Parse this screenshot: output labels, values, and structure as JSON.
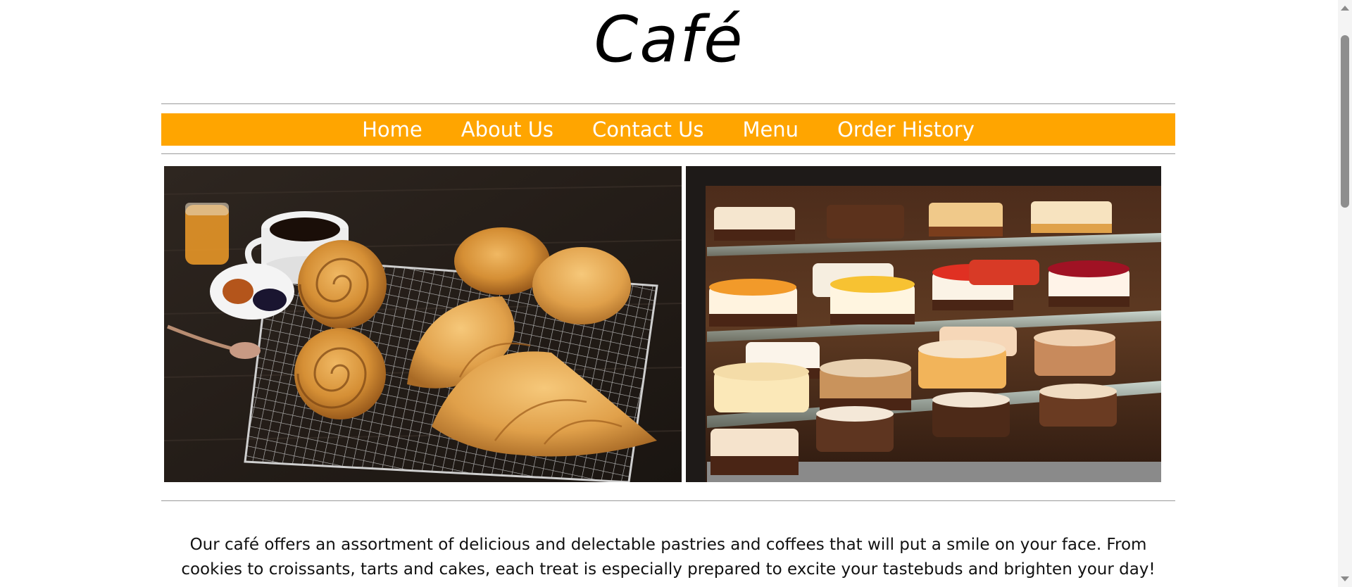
{
  "header": {
    "title": "Café"
  },
  "nav": {
    "items": [
      {
        "label": "Home"
      },
      {
        "label": "About Us"
      },
      {
        "label": "Contact Us"
      },
      {
        "label": "Menu"
      },
      {
        "label": "Order History"
      }
    ],
    "background_color": "#ffa500",
    "text_color": "#ffffff"
  },
  "hero": {
    "left_image": "pastries-and-coffee-photo",
    "right_image": "cake-display-case-photo"
  },
  "main": {
    "description": "Our café offers an assortment of delicious and delectable pastries and coffees that will put a smile on your face. From cookies to croissants, tarts and cakes, each treat is especially prepared to excite your tastebuds and brighten your day!"
  }
}
